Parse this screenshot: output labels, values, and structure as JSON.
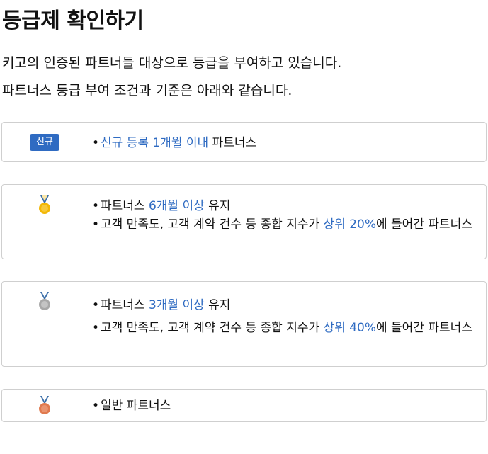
{
  "title": "등급제 확인하기",
  "description": {
    "line1": "키고의 인증된 파트너들 대상으로 등급을 부여하고 있습니다.",
    "line2": "파트너스 등급 부여 조건과 기준은 아래와 같습니다."
  },
  "colors": {
    "accent": "#2f6bc2",
    "gold": "#f2b705",
    "silver": "#b5b5b5",
    "bronze": "#e07a4f",
    "ribbon": "#3a6ea8"
  },
  "tiers": {
    "new": {
      "badge_label": "신규",
      "b1_highlight": "신규 등록 1개월 이내",
      "b1_rest": " 파트너스"
    },
    "gold": {
      "icon": "gold-medal-icon",
      "b1_prefix": "파트너스 ",
      "b1_highlight": "6개월 이상",
      "b1_suffix": " 유지",
      "b2_prefix": "고객 만족도, 고객 계약 건수 등 종합 지수가 ",
      "b2_highlight": "상위 20%",
      "b2_suffix": "에 들어간 파트너스"
    },
    "silver": {
      "icon": "silver-medal-icon",
      "b1_prefix": "파트너스 ",
      "b1_highlight": "3개월 이상",
      "b1_suffix": " 유지",
      "b2_prefix": "고객 만족도, 고객 계약 건수 등 종합 지수가 ",
      "b2_highlight": "상위 40%",
      "b2_suffix": "에 들어간 파트너스"
    },
    "bronze": {
      "icon": "bronze-medal-icon",
      "b1": "일반 파트너스"
    }
  }
}
